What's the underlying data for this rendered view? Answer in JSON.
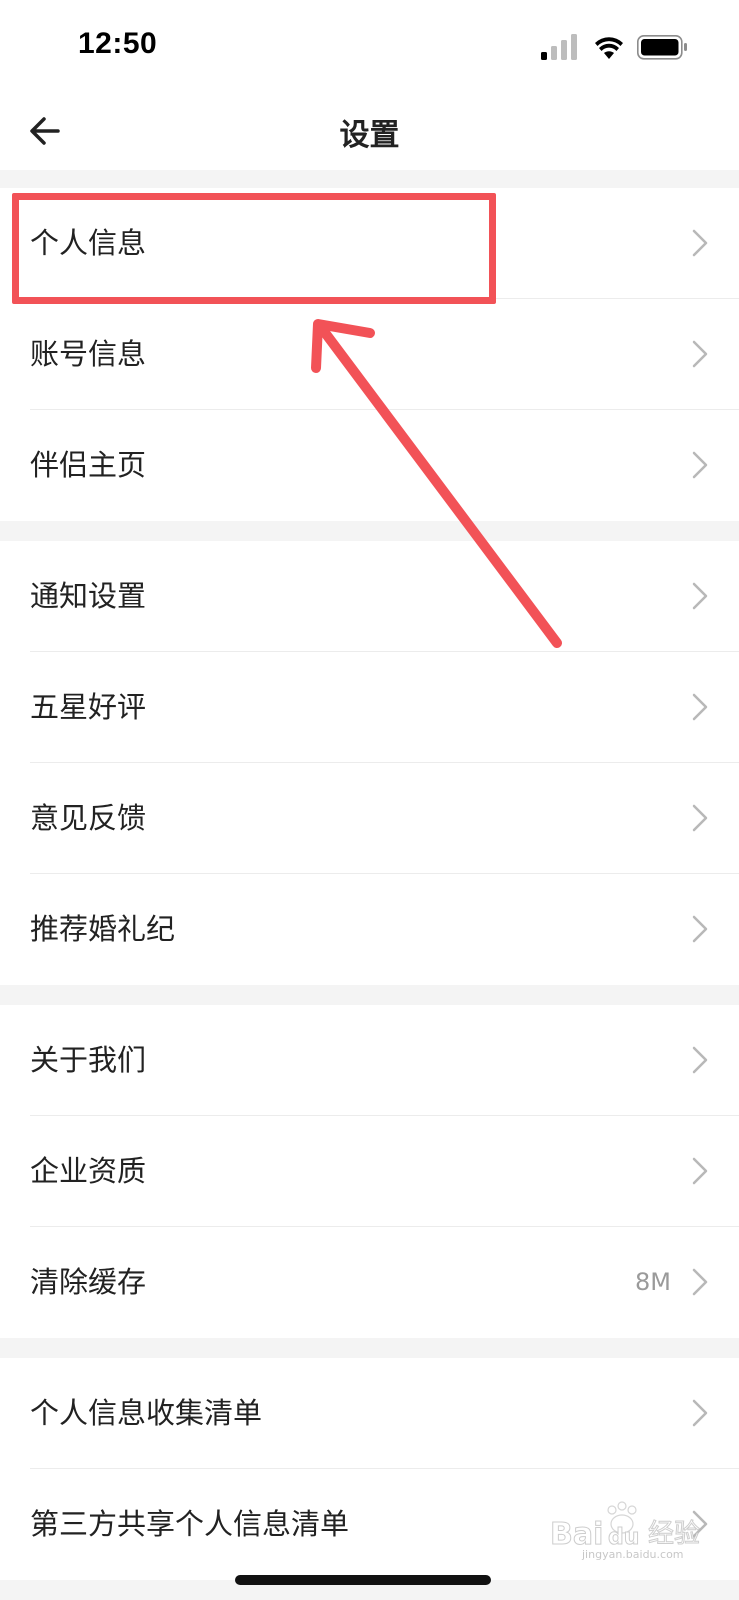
{
  "status_bar": {
    "time": "12:50"
  },
  "nav": {
    "title": "设置"
  },
  "groups": [
    {
      "items": [
        {
          "label": "个人信息"
        },
        {
          "label": "账号信息"
        },
        {
          "label": "伴侣主页"
        }
      ]
    },
    {
      "items": [
        {
          "label": "通知设置"
        },
        {
          "label": "五星好评"
        },
        {
          "label": "意见反馈"
        },
        {
          "label": "推荐婚礼纪"
        }
      ]
    },
    {
      "items": [
        {
          "label": "关于我们"
        },
        {
          "label": "企业资质"
        },
        {
          "label": "清除缓存",
          "value": "8M"
        }
      ]
    },
    {
      "items": [
        {
          "label": "个人信息收集清单"
        },
        {
          "label": "第三方共享个人信息清单"
        }
      ]
    }
  ],
  "watermark": {
    "text": "Baidu 经验",
    "sub": "jingyan.baidu.com"
  },
  "colors": {
    "annotation": "#f25257",
    "background": "#f4f4f4",
    "text": "#222222",
    "secondary": "#9a9a9a"
  }
}
